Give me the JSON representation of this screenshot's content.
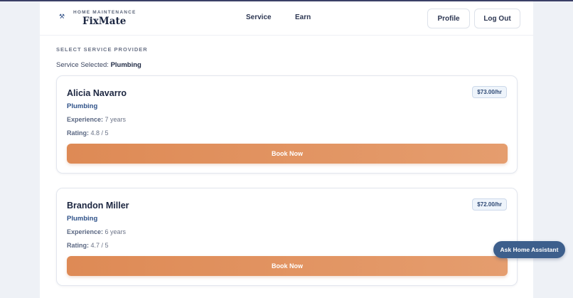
{
  "header": {
    "brand_top": "HOME MAINTENANCE",
    "brand_name": "FixMate",
    "logo_icon": "house-wrench-icon",
    "nav": [
      "Service",
      "Earn"
    ],
    "profile_label": "Profile",
    "logout_label": "Log Out"
  },
  "main": {
    "section_label": "SELECT SERVICE PROVIDER",
    "selected_prefix": "Service Selected:",
    "selected_value": "Plumbing",
    "providers": [
      {
        "name": "Alicia Navarro",
        "price": "$73.00/hr",
        "specialty": "Plumbing",
        "experience_label": "Experience:",
        "experience_value": "7 years",
        "rating_label": "Rating:",
        "rating_value": "4.8 / 5",
        "button_label": "Book Now"
      },
      {
        "name": "Brandon Miller",
        "price": "$72.00/hr",
        "specialty": "Plumbing",
        "experience_label": "Experience:",
        "experience_value": "6 years",
        "rating_label": "Rating:",
        "rating_value": "4.7 / 5",
        "button_label": "Book Now"
      }
    ]
  },
  "assistant": {
    "label": "Ask Home Assistant"
  },
  "colors": {
    "accent": "#de8a55",
    "brand": "#2f5289",
    "assistant": "#3d5f8c"
  }
}
